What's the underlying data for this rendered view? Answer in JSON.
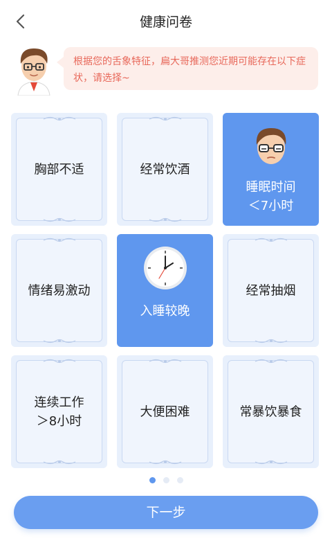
{
  "header": {
    "title": "健康问卷",
    "back_icon": "chevron-left-icon"
  },
  "assistant": {
    "avatar_icon": "doctor-avatar",
    "message": "根据您的舌象特征，扁大哥推测您近期可能存在以下症状，请选择~"
  },
  "options": [
    {
      "label": "胸部不适",
      "selected": false
    },
    {
      "label": "经常饮酒",
      "selected": false
    },
    {
      "label": "睡眠时间\n＜7小时",
      "selected": true,
      "icon": "doctor-face-icon"
    },
    {
      "label": "情绪易激动",
      "selected": false
    },
    {
      "label": "入睡较晚",
      "selected": true,
      "icon": "clock-icon"
    },
    {
      "label": "经常抽烟",
      "selected": false
    },
    {
      "label": "连续工作\n＞8小时",
      "selected": false
    },
    {
      "label": "大便困难",
      "selected": false
    },
    {
      "label": "常暴饮暴食",
      "selected": false
    }
  ],
  "pagination": {
    "total": 3,
    "current": 1
  },
  "footer": {
    "next_label": "下一步"
  },
  "colors": {
    "accent": "#5f97ee",
    "card_bg": "#e8f0fc",
    "bubble_bg": "#fdeeea",
    "bubble_text": "#e8685a"
  }
}
